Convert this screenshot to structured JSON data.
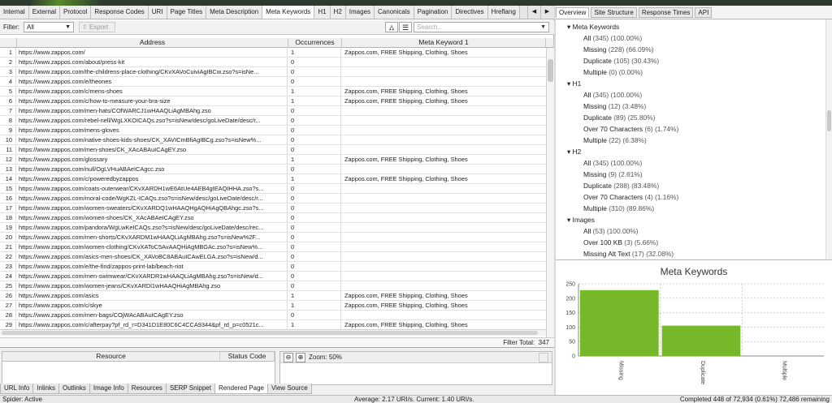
{
  "tabs": [
    "Internal",
    "External",
    "Protocol",
    "Response Codes",
    "URI",
    "Page Titles",
    "Meta Description",
    "Meta Keywords",
    "H1",
    "H2",
    "Images",
    "Canonicals",
    "Pagination",
    "Directives",
    "Hreflang"
  ],
  "active_tab": "Meta Keywords",
  "filter": {
    "label": "Filter:",
    "value": "All",
    "export_label": "Export",
    "search_placeholder": "Search..."
  },
  "table": {
    "headers": [
      "Address",
      "Occurrences",
      "Meta Keyword 1"
    ],
    "rows": [
      [
        "1",
        "https://www.zappos.com/",
        "1",
        "Zappos.com, FREE Shipping, Clothing, Shoes"
      ],
      [
        "2",
        "https://www.zappos.com/about/press-kit",
        "0",
        ""
      ],
      [
        "3",
        "https://www.zappos.com/the-childrens-place-clothing/CKvXAVoCuiviAgIBCw.zso?s=isNe...",
        "0",
        ""
      ],
      [
        "4",
        "https://www.zappos.com/e/theones",
        "0",
        ""
      ],
      [
        "5",
        "https://www.zappos.com/c/mens-shoes",
        "1",
        "Zappos.com, FREE Shipping, Clothing, Shoes"
      ],
      [
        "6",
        "https://www.zappos.com/c/how-to-measure-your-bra-size",
        "1",
        "Zappos.com, FREE Shipping, Clothing, Shoes"
      ],
      [
        "7",
        "https://www.zappos.com/men-hats/COfWARCJ1wHAAQLiAgMBAhg.zso",
        "0",
        ""
      ],
      [
        "8",
        "https://www.zappos.com/rebel-nell/WgLXKOICAQs.zso?s=isNew/desc/goLiveDate/desc/r...",
        "0",
        ""
      ],
      [
        "9",
        "https://www.zappos.com/mens-gloves",
        "0",
        ""
      ],
      [
        "10",
        "https://www.zappos.com/native-shoes-kids-shoes/CK_XAVICmBfiAgIBCg.zso?s=isNew%...",
        "0",
        ""
      ],
      [
        "11",
        "https://www.zappos.com/men-shoes/CK_XAcABAuICAgEY.zso",
        "0",
        ""
      ],
      [
        "12",
        "https://www.zappos.com/glossary",
        "1",
        "Zappos.com, FREE Shipping, Clothing, Shoes"
      ],
      [
        "13",
        "https://www.zappos.com/null/OgLVHuABAeICAgcc.zso",
        "0",
        ""
      ],
      [
        "14",
        "https://www.zappos.com/c/poweredbyzappos",
        "1",
        "Zappos.com, FREE Shipping, Clothing, Shoes"
      ],
      [
        "15",
        "https://www.zappos.com/coats-outerwear/CKvXARDH1wE6AtUe4AEB4gIEAQIHHA.zso?s...",
        "0",
        ""
      ],
      [
        "16",
        "https://www.zappos.com/moral-code/WgKZL-ICAQs.zso?s=isNew/desc/goLiveDate/desc/r...",
        "0",
        ""
      ],
      [
        "17",
        "https://www.zappos.com/women-sweaters/CKvXARDQ1wHAAQHgAQHiAgQBAhgc.zso?s...",
        "0",
        ""
      ],
      [
        "18",
        "https://www.zappos.com/women-shoes/CK_XAcABAeICAgEY.zso",
        "0",
        ""
      ],
      [
        "19",
        "https://www.zappos.com/pandora/WgLwKeICAQs.zso?s=isNew/desc/goLiveDate/desc/rec...",
        "0",
        ""
      ],
      [
        "20",
        "https://www.zappos.com/men-shorts/CKvXARDM1wHAAQLiAgMBAhg.zso?s=isNew%2F...",
        "0",
        ""
      ],
      [
        "21",
        "https://www.zappos.com/women-clothing/CKvXAToC5AvAAQHiAgMBGAc.zso?s=isNew%...",
        "0",
        ""
      ],
      [
        "22",
        "https://www.zappos.com/asics-men-shoes/CK_XAVoBC8ABAuICAwELGA.zso?s=isNew/d...",
        "0",
        ""
      ],
      [
        "23",
        "https://www.zappos.com/e/the-find/zappos-print-lab/beach-riot",
        "0",
        ""
      ],
      [
        "24",
        "https://www.zappos.com/men-swimwear/CKvXARDR1wHAAQLiAgMBAhg.zso?s=isNew/d...",
        "0",
        ""
      ],
      [
        "25",
        "https://www.zappos.com/women-jeans/CKvXARDl1wHAAQHiAgMBAhg.zso",
        "0",
        ""
      ],
      [
        "26",
        "https://www.zappos.com/asics",
        "1",
        "Zappos.com, FREE Shipping, Clothing, Shoes"
      ],
      [
        "27",
        "https://www.zappos.com/c/skye",
        "1",
        "Zappos.com, FREE Shipping, Clothing, Shoes"
      ],
      [
        "28",
        "https://www.zappos.com/men-bags/COjWAcABAuICAgEY.zso",
        "0",
        ""
      ],
      [
        "29",
        "https://www.zappos.com/c/afterpay?pf_rd_r=D341D1E80C6C4CCA9344&pf_rd_p=c0521c...",
        "1",
        "Zappos.com, FREE Shipping, Clothing, Shoes"
      ]
    ]
  },
  "filter_total_label": "Filter Total:",
  "filter_total": "347",
  "bottom": {
    "headers": [
      "Resource",
      "Status Code"
    ],
    "zoom_label": "Zoom: 50%",
    "tabs": [
      "URL Info",
      "Inlinks",
      "Outlinks",
      "Image Info",
      "Resources",
      "SERP Snippet",
      "Rendered Page",
      "View Source"
    ],
    "active_tab": "Rendered Page"
  },
  "status": {
    "left": "Spider: Active",
    "middle": "Average: 2.17 URI/s. Current: 1.40 URI/s.",
    "right": "Completed 448 of 72,934 (0.61%) 72,486 remaining"
  },
  "right_tabs": [
    "Overview",
    "Site Structure",
    "Response Times",
    "API"
  ],
  "right_active_tab": "Overview",
  "tree": {
    "groups": [
      {
        "label": "Meta Keywords",
        "items": [
          {
            "label": "All",
            "pct": "(345) (100.00%)"
          },
          {
            "label": "Missing",
            "pct": "(228) (66.09%)"
          },
          {
            "label": "Duplicate",
            "pct": "(105) (30.43%)"
          },
          {
            "label": "Multiple",
            "pct": "(0) (0.00%)"
          }
        ]
      },
      {
        "label": "H1",
        "items": [
          {
            "label": "All",
            "pct": "(345) (100.00%)"
          },
          {
            "label": "Missing",
            "pct": "(12) (3.48%)"
          },
          {
            "label": "Duplicate",
            "pct": "(89) (25.80%)"
          },
          {
            "label": "Over 70 Characters",
            "pct": "(6) (1.74%)"
          },
          {
            "label": "Multiple",
            "pct": "(22) (6.38%)"
          }
        ]
      },
      {
        "label": "H2",
        "items": [
          {
            "label": "All",
            "pct": "(345) (100.00%)"
          },
          {
            "label": "Missing",
            "pct": "(9) (2.61%)"
          },
          {
            "label": "Duplicate",
            "pct": "(288) (83.48%)"
          },
          {
            "label": "Over 70 Characters",
            "pct": "(4) (1.16%)"
          },
          {
            "label": "Multiple",
            "pct": "(310) (89.86%)"
          }
        ]
      },
      {
        "label": "Images",
        "items": [
          {
            "label": "All",
            "pct": "(53) (100.00%)"
          },
          {
            "label": "Over 100 KB",
            "pct": "(3) (5.66%)"
          },
          {
            "label": "Missing Alt Text",
            "pct": "(17) (32.08%)"
          }
        ]
      }
    ]
  },
  "chart_data": {
    "type": "bar",
    "title": "Meta Keywords",
    "categories": [
      "Missing",
      "Duplicate",
      "Multiple"
    ],
    "values": [
      228,
      105,
      0
    ],
    "ylim": [
      0,
      250
    ],
    "yticks": [
      "0",
      "50",
      "100",
      "150",
      "200",
      "250"
    ],
    "bar_color": "#76b82a",
    "grid": true
  }
}
